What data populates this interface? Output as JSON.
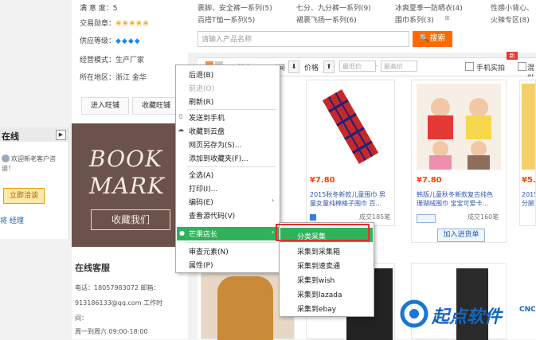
{
  "seller": {
    "satisfaction": "满 意 度：5",
    "trade_medal_label": "交易勋章：",
    "trade_medal_icons": "❀❀❀❀❀",
    "supply_level_label": "供应等级：",
    "supply_level_icons": "◆◆◆◆",
    "mode": "经营模式：生产厂家",
    "location": "所在地区：浙江 金华",
    "enter_shop": "进入旺铺",
    "fav_shop": "收藏旺铺"
  },
  "bookmark": {
    "line1": "BOOK",
    "line2": "MARK",
    "button": "收藏我们"
  },
  "online": {
    "title": "在线",
    "text1": "欢迎新老客户咨",
    "text2": "谈！",
    "consult": "立即洽谈",
    "footer": "将 经理"
  },
  "service": {
    "title": "在线客服",
    "phone": "电话：18057983072 邮箱：",
    "email": "913186133@qq.com 工作时",
    "time_label": "间：",
    "hours": "周一到周六 09:00-18:00"
  },
  "categories": [
    "裹脚、安全裤一系列(5)",
    "七分、九分裤一系列(9)",
    "冰爽夏季一防晒衣(4)",
    "性感小背心、",
    "百搭T恤一系列(5)",
    "裙裹飞扬一系列(6)",
    "围巾系列(3)",
    "火辣专区(8)"
  ],
  "search": {
    "placeholder": "请输入产品名称",
    "button": "搜索"
  },
  "filters": {
    "price_label": "价格",
    "min_placeholder": "最低价",
    "max_placeholder": "最高价",
    "time_label": "时间",
    "sort_label": "综合",
    "phone_check": "手机实拍",
    "mix_check": "混批",
    "new_badge": "新"
  },
  "products": [
    {
      "price": "¥7.80",
      "title1": "2015秋冬新款儿童围巾 男",
      "title2": "童女童纯棉格子围巾 百...",
      "sales": "成交185笔"
    },
    {
      "price": "¥7.80",
      "title1": "韩版儿童秋冬新款复古纯色",
      "title2": "珊瑚绒围巾 宝宝可爱卡...",
      "sales": "成交160笔",
      "add_btn": "加入进货单"
    },
    {
      "price": "¥5.6",
      "title1": "2015秋",
      "title2": "分腿"
    }
  ],
  "menu": {
    "items": [
      "后退(B)",
      "前进(O)",
      "刷新(R)",
      "发送到手机",
      "收藏到云盘",
      "网页另存为(S)...",
      "添加到收藏夹(F)...",
      "全选(A)",
      "打印(I)...",
      "编码(E)",
      "查看源代码(V)",
      "芒果店长",
      "审查元素(N)",
      "属性(P)"
    ]
  },
  "submenu": {
    "items": [
      "分类采集",
      "采集到采集箱",
      "采集到速卖通",
      "采集到wish",
      "采集到lazada",
      "采集到ebay"
    ]
  },
  "watermark": {
    "text": "起点软件",
    "sub": "CNC"
  },
  "colors": {
    "accent": "#ff6a00",
    "menu_highlight": "#2fb35a",
    "highlight_box": "#e23030",
    "price": "#ff4400"
  }
}
